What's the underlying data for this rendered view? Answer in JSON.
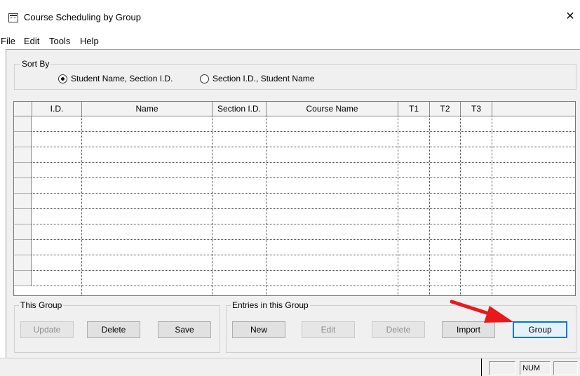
{
  "window": {
    "title": "Course Scheduling by Group",
    "close_glyph": "✕"
  },
  "menu": {
    "items": [
      "File",
      "Edit",
      "Tools",
      "Help"
    ]
  },
  "sort_by": {
    "legend": "Sort By",
    "options": [
      {
        "label": "Student Name, Section I.D.",
        "checked": true
      },
      {
        "label": "Section I.D., Student Name",
        "checked": false
      }
    ]
  },
  "grid": {
    "columns": [
      "I.D.",
      "Name",
      "Section I.D.",
      "Course Name",
      "T1",
      "T2",
      "T3",
      ""
    ],
    "row_count": 11
  },
  "this_group": {
    "legend": "This Group",
    "update_label": "Update",
    "delete_label": "Delete",
    "save_label": "Save"
  },
  "entries": {
    "legend": "Entries in this Group",
    "new_label": "New",
    "edit_label": "Edit",
    "delete_label": "Delete",
    "import_label": "Import",
    "group_label": "Group"
  },
  "status": {
    "num": "NUM"
  },
  "colors": {
    "arrow": "#e8191c",
    "accent": "#0078d7"
  }
}
